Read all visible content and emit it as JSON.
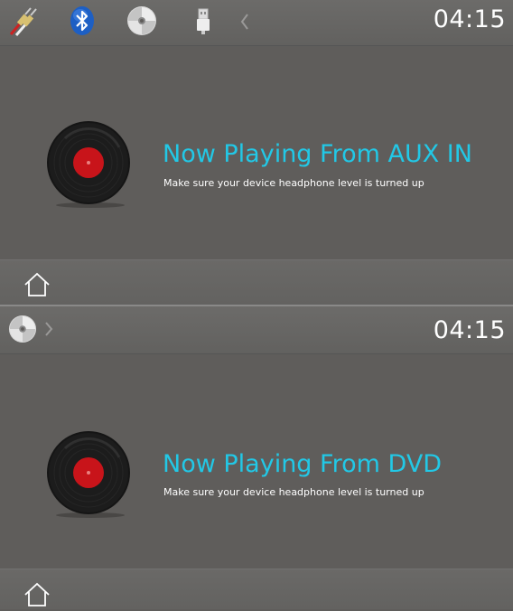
{
  "screens": [
    {
      "topbar": {
        "icons": [
          "rca-cable-icon",
          "bluetooth-icon",
          "disc-icon",
          "usb-icon",
          "chevron-left-icon"
        ],
        "clock": "04:15"
      },
      "content": {
        "title": "Now Playing From AUX IN",
        "subtitle": "Make sure your device headphone level is turned up"
      },
      "bottombar": {
        "icons": [
          "home-icon"
        ]
      }
    },
    {
      "topbar": {
        "icons": [
          "disc-icon",
          "chevron-right-icon"
        ],
        "clock": "04:15"
      },
      "content": {
        "title": "Now Playing From DVD",
        "subtitle": "Make sure your device headphone level is turned up"
      },
      "bottombar": {
        "icons": [
          "home-icon"
        ]
      }
    }
  ],
  "colors": {
    "accent": "#22c8e6",
    "background": "#5f5d5b",
    "record_label": "#c8141a"
  }
}
